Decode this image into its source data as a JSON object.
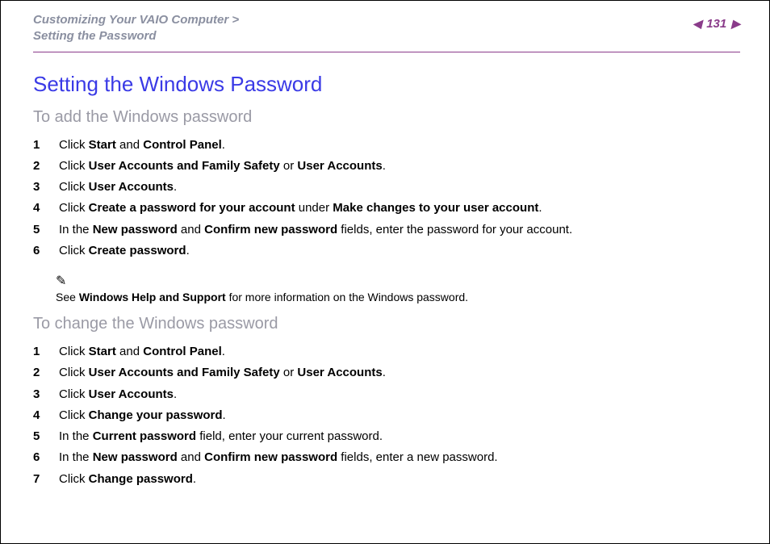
{
  "header": {
    "breadcrumb_line1": "Customizing Your VAIO Computer >",
    "breadcrumb_line2": "Setting the Password",
    "page_number": "131"
  },
  "title": "Setting the Windows Password",
  "section_add": {
    "heading": "To add the Windows password",
    "steps": [
      {
        "n": "1",
        "parts": [
          "Click ",
          [
            "b",
            "Start"
          ],
          " and ",
          [
            "b",
            "Control Panel"
          ],
          "."
        ]
      },
      {
        "n": "2",
        "parts": [
          "Click ",
          [
            "b",
            "User Accounts and Family Safety"
          ],
          " or ",
          [
            "b",
            "User Accounts"
          ],
          "."
        ]
      },
      {
        "n": "3",
        "parts": [
          "Click ",
          [
            "b",
            "User Accounts"
          ],
          "."
        ]
      },
      {
        "n": "4",
        "parts": [
          "Click ",
          [
            "b",
            "Create a password for your account"
          ],
          " under ",
          [
            "b",
            "Make changes to your user account"
          ],
          "."
        ]
      },
      {
        "n": "5",
        "parts": [
          "In the ",
          [
            "b",
            "New password"
          ],
          " and ",
          [
            "b",
            "Confirm new password"
          ],
          " fields, enter the password for your account."
        ]
      },
      {
        "n": "6",
        "parts": [
          "Click ",
          [
            "b",
            "Create password"
          ],
          "."
        ]
      }
    ]
  },
  "note": {
    "icon": "✎",
    "parts": [
      "See ",
      [
        "b",
        "Windows Help and Support"
      ],
      " for more information on the Windows password."
    ]
  },
  "section_change": {
    "heading": "To change the Windows password",
    "steps": [
      {
        "n": "1",
        "parts": [
          "Click ",
          [
            "b",
            "Start"
          ],
          " and ",
          [
            "b",
            "Control Panel"
          ],
          "."
        ]
      },
      {
        "n": "2",
        "parts": [
          "Click ",
          [
            "b",
            "User Accounts and Family Safety"
          ],
          " or ",
          [
            "b",
            "User Accounts"
          ],
          "."
        ]
      },
      {
        "n": "3",
        "parts": [
          "Click ",
          [
            "b",
            "User Accounts"
          ],
          "."
        ]
      },
      {
        "n": "4",
        "parts": [
          "Click ",
          [
            "b",
            "Change your password"
          ],
          "."
        ]
      },
      {
        "n": "5",
        "parts": [
          "In the ",
          [
            "b",
            "Current password"
          ],
          " field, enter your current password."
        ]
      },
      {
        "n": "6",
        "parts": [
          "In the ",
          [
            "b",
            "New password"
          ],
          " and ",
          [
            "b",
            "Confirm new password"
          ],
          " fields, enter a new password."
        ]
      },
      {
        "n": "7",
        "parts": [
          "Click ",
          [
            "b",
            "Change password"
          ],
          "."
        ]
      }
    ]
  }
}
